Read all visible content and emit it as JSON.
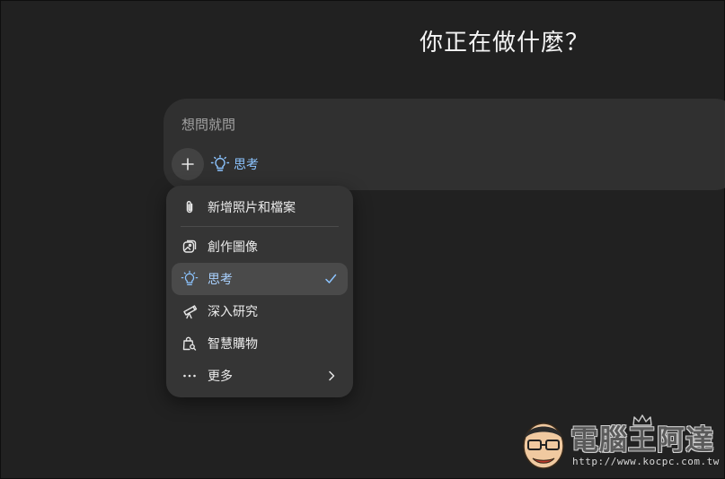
{
  "headline": "你正在做什麼？",
  "composer": {
    "placeholder": "想問就問",
    "plus_icon": "plus-icon",
    "active_tool": {
      "icon": "lightbulb-icon",
      "label": "思考"
    }
  },
  "menu": {
    "items": [
      {
        "icon": "paperclip-icon",
        "label": "新增照片和檔案"
      },
      {
        "icon": "image-create-icon",
        "label": "創作圖像"
      },
      {
        "icon": "lightbulb-icon",
        "label": "思考",
        "selected": true,
        "trailing": "check-icon"
      },
      {
        "icon": "telescope-icon",
        "label": "深入研究"
      },
      {
        "icon": "shopping-bag-search-icon",
        "label": "智慧購物"
      },
      {
        "icon": "ellipsis-icon",
        "label": "更多",
        "trailing": "chevron-right-icon"
      }
    ]
  },
  "watermark": {
    "title": "電腦王阿達",
    "url": "http://www.kocpc.com.tw"
  },
  "colors": {
    "background": "#212121",
    "composer": "#303030",
    "menu": "#353535",
    "accent": "#8cc4ff"
  }
}
